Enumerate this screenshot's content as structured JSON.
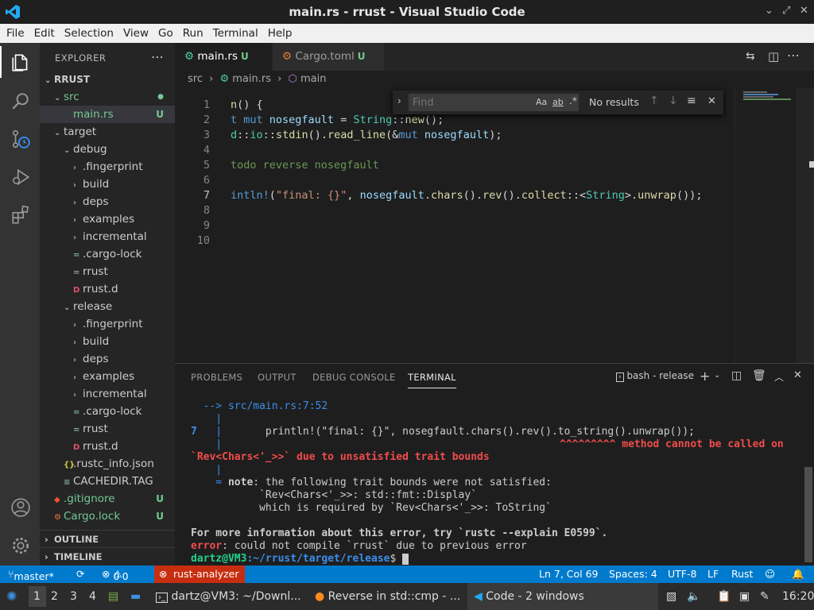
{
  "window": {
    "title": "main.rs - rrust - Visual Studio Code"
  },
  "menu": [
    "File",
    "Edit",
    "Selection",
    "View",
    "Go",
    "Run",
    "Terminal",
    "Help"
  ],
  "sidebar": {
    "header": "EXPLORER",
    "root": "RRUST",
    "items": [
      {
        "label": "src",
        "indent": 1,
        "chev": "⌄",
        "kind": "folder",
        "badge": "●",
        "color": "#73c991"
      },
      {
        "label": "main.rs",
        "indent": 2,
        "kind": "file",
        "badge": "U",
        "color": "#73c991",
        "sel": true
      },
      {
        "label": "target",
        "indent": 1,
        "chev": "⌄",
        "kind": "folder"
      },
      {
        "label": "debug",
        "indent": 2,
        "chev": "⌄",
        "kind": "folder"
      },
      {
        "label": ".fingerprint",
        "indent": 3,
        "chev": "›",
        "kind": "folder"
      },
      {
        "label": "build",
        "indent": 3,
        "chev": "›",
        "kind": "folder"
      },
      {
        "label": "deps",
        "indent": 3,
        "chev": "›",
        "kind": "folder"
      },
      {
        "label": "examples",
        "indent": 3,
        "chev": "›",
        "kind": "folder"
      },
      {
        "label": "incremental",
        "indent": 3,
        "chev": "›",
        "kind": "folder"
      },
      {
        "label": ".cargo-lock",
        "indent": 3,
        "kind": "file",
        "icon": "="
      },
      {
        "label": "rrust",
        "indent": 3,
        "kind": "file",
        "icon": "="
      },
      {
        "label": "rrust.d",
        "indent": 3,
        "kind": "file",
        "icon": "D"
      },
      {
        "label": "release",
        "indent": 2,
        "chev": "⌄",
        "kind": "folder"
      },
      {
        "label": ".fingerprint",
        "indent": 3,
        "chev": "›",
        "kind": "folder"
      },
      {
        "label": "build",
        "indent": 3,
        "chev": "›",
        "kind": "folder"
      },
      {
        "label": "deps",
        "indent": 3,
        "chev": "›",
        "kind": "folder"
      },
      {
        "label": "examples",
        "indent": 3,
        "chev": "›",
        "kind": "folder"
      },
      {
        "label": "incremental",
        "indent": 3,
        "chev": "›",
        "kind": "folder"
      },
      {
        "label": ".cargo-lock",
        "indent": 3,
        "kind": "file",
        "icon": "="
      },
      {
        "label": "rrust",
        "indent": 3,
        "kind": "file",
        "icon": "="
      },
      {
        "label": "rrust.d",
        "indent": 3,
        "kind": "file",
        "icon": "D"
      },
      {
        "label": ".rustc_info.json",
        "indent": 2,
        "kind": "file",
        "icon": "{}"
      },
      {
        "label": "CACHEDIR.TAG",
        "indent": 2,
        "kind": "file",
        "icon": "≡"
      },
      {
        "label": ".gitignore",
        "indent": 1,
        "kind": "file",
        "icon": "◆",
        "badge": "U",
        "color": "#73c991"
      },
      {
        "label": "Cargo.lock",
        "indent": 1,
        "kind": "file",
        "icon": "⚙",
        "badge": "U",
        "color": "#73c991"
      }
    ],
    "outline": "OUTLINE",
    "timeline": "TIMELINE"
  },
  "tabs": [
    {
      "label": "main.rs",
      "badge": "U"
    },
    {
      "label": "Cargo.toml",
      "badge": "U"
    }
  ],
  "breadcrumb": {
    "a": "src",
    "b": "main.rs",
    "c": "main"
  },
  "find": {
    "placeholder": "Find",
    "aa": "Aa",
    "ab": "ab",
    "results": "No results"
  },
  "editor": {
    "lines": [
      "1",
      "2",
      "3",
      "4",
      "5",
      "6",
      "7",
      "8",
      "9",
      "10"
    ]
  },
  "panel": {
    "tabs": [
      "PROBLEMS",
      "OUTPUT",
      "DEBUG CONSOLE",
      "TERMINAL"
    ],
    "shell": "bash - release"
  },
  "terminal": {
    "l1": "  --> src/main.rs:7:52",
    "l2a": "7",
    "l2b": "       println!(\"final: {}\", nosegfault.chars().rev().to_string().unwrap());",
    "l3a": "^^^^^^^^^ method cannot be called on",
    "l3b": "`Rev<Chars<'_>>` due to unsatisfied trait bounds",
    "note": "note",
    "noteText": ": the following trait bounds were not satisfied:",
    "b1": "           `Rev<Chars<'_>>: std::fmt::Display`",
    "b2": "           which is required by `Rev<Chars<'_>>: ToString`",
    "more": "For more information about this error, try `rustc --explain E0599`.",
    "err": "error",
    "errText": ": could not compile `rrust` due to previous error",
    "user": "dartz@VM3",
    "path": ":~/rrust/target/release",
    "prompt": "$ "
  },
  "status": {
    "branch": "master*",
    "errors": "0",
    "warnings": "0",
    "ra": "rust-analyzer",
    "pos": "Ln 7, Col 69",
    "spaces": "Spaces: 4",
    "enc": "UTF-8",
    "eol": "LF",
    "lang": "Rust"
  },
  "taskbar": {
    "ws": [
      "1",
      "2",
      "3",
      "4"
    ],
    "t1": "dartz@VM3: ~/Downl...",
    "t2": "Reverse in std::cmp - ...",
    "t3": "Code - 2 windows",
    "clock": "16:20"
  }
}
